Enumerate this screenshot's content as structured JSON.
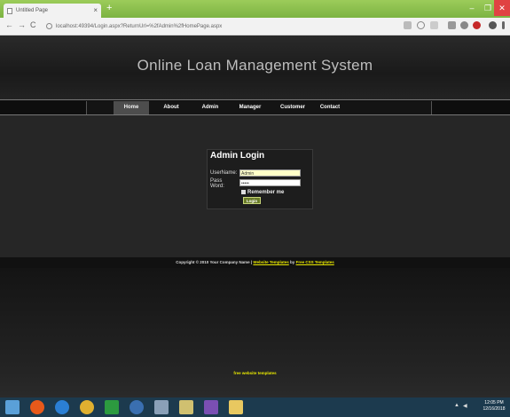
{
  "browser": {
    "tab_title": "Untitled Page",
    "tab_close": "×",
    "new_tab": "+",
    "min": "–",
    "max": "❐",
    "close": "✕",
    "back": "←",
    "forward": "→",
    "reload": "C",
    "url": "localhost:49394/Login.aspx?ReturnUrl=%2fAdmin%2fHomePage.aspx"
  },
  "site": {
    "title": "Online Loan Management System",
    "menu": [
      {
        "label": "Home",
        "active": true
      },
      {
        "label": "About"
      },
      {
        "label": "Admin"
      },
      {
        "label": "Manager"
      },
      {
        "label": "Customer"
      },
      {
        "label": "Contact"
      }
    ]
  },
  "login": {
    "title": "Admin Login",
    "username_label": "UserName:",
    "username_value": "Admin",
    "password_label_1": "Pass",
    "password_label_2": "Word:",
    "password_value": "•••••",
    "remember_label": "Remember me",
    "button_label": "Login"
  },
  "footer": {
    "copyright_prefix": "Copyright © 2010 Your Company Name |",
    "link1": "Website Templates",
    "by": "by",
    "link2": "Free CSS Templates",
    "templates_text": "free website templates"
  },
  "taskbar": {
    "clock_time": "12:05 PM",
    "clock_date": "12/16/2018"
  },
  "colors": {
    "chrome_green": "#8bc34a",
    "accent_yellow": "#e8e800",
    "taskbar": "#1c3a4e"
  }
}
